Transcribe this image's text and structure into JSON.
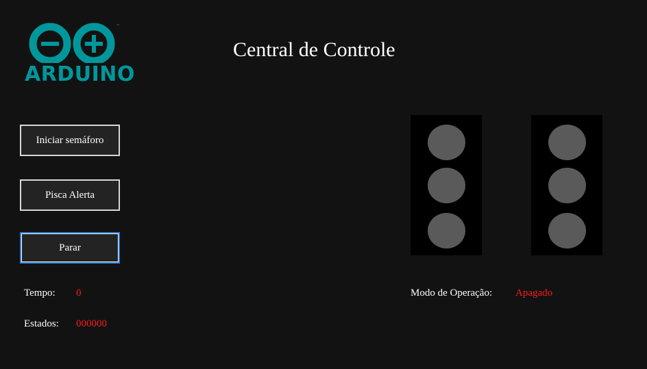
{
  "logo": {
    "text": "ARDUINO",
    "tm": "™",
    "color": "#00979c"
  },
  "header": {
    "title": "Central de Controle"
  },
  "controls": {
    "start_label": "Iniciar semáforo",
    "alert_label": "Pisca Alerta",
    "stop_label": "Parar"
  },
  "status": {
    "time_label": "Tempo:",
    "time_value": "0",
    "states_label": "Estados:",
    "states_value": "000000",
    "mode_label": "Modo de Operação:",
    "mode_value": "Apagado"
  },
  "traffic_lights": [
    {
      "lamps": [
        "off",
        "off",
        "off"
      ]
    },
    {
      "lamps": [
        "off",
        "off",
        "off"
      ]
    }
  ],
  "colors": {
    "background": "#121212",
    "lamp_off": "#5a5a5a",
    "value_text": "#ff1a1a",
    "focus_border": "#2d7fd6"
  }
}
